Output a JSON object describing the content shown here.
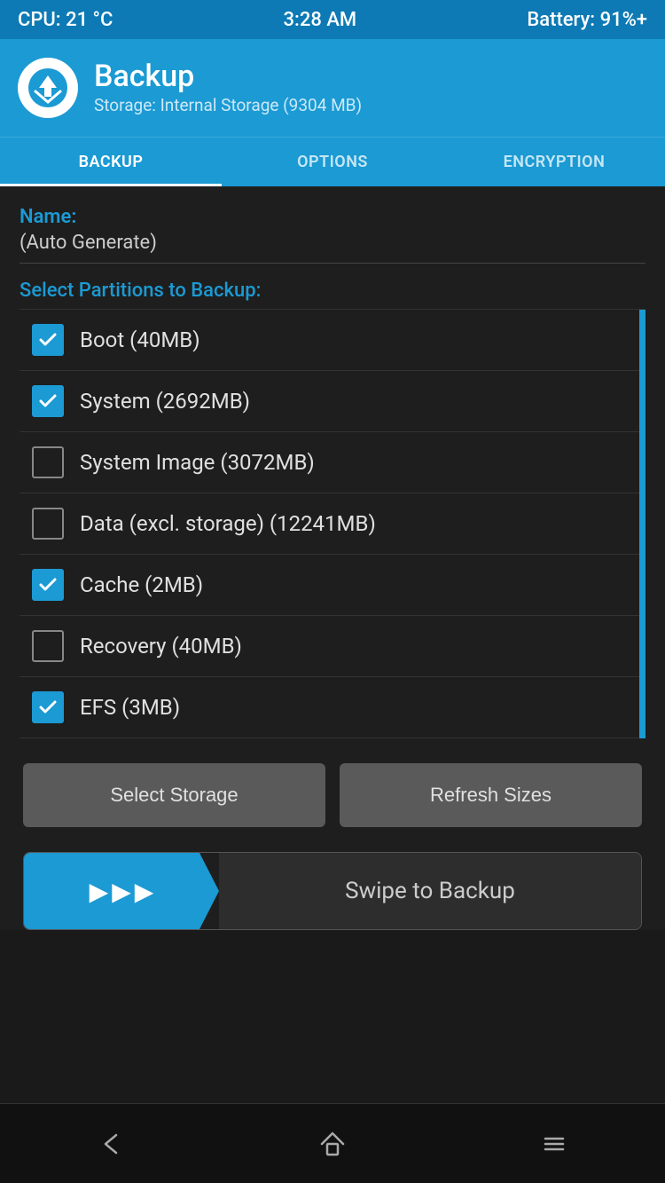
{
  "statusBar": {
    "cpu": "CPU: 21 °C",
    "time": "3:28 AM",
    "battery": "Battery: 91%+"
  },
  "header": {
    "title": "Backup",
    "subtitle": "Storage: Internal Storage (9304 MB)"
  },
  "tabs": [
    {
      "label": "BACKUP",
      "active": true
    },
    {
      "label": "OPTIONS",
      "active": false
    },
    {
      "label": "ENCRYPTION",
      "active": false
    }
  ],
  "nameLabel": "Name:",
  "nameValue": "(Auto Generate)",
  "sectionTitle": "Select Partitions to Backup:",
  "partitions": [
    {
      "label": "Boot (40MB)",
      "checked": true
    },
    {
      "label": "System (2692MB)",
      "checked": true
    },
    {
      "label": "System Image (3072MB)",
      "checked": false
    },
    {
      "label": "Data (excl. storage) (12241MB)",
      "checked": false
    },
    {
      "label": "Cache (2MB)",
      "checked": true
    },
    {
      "label": "Recovery (40MB)",
      "checked": false
    },
    {
      "label": "EFS (3MB)",
      "checked": true
    }
  ],
  "buttons": {
    "selectStorage": "Select Storage",
    "refreshSizes": "Refresh Sizes"
  },
  "swipe": {
    "label": "Swipe to Backup"
  },
  "bottomNav": {
    "back": "back-icon",
    "home": "home-icon",
    "menu": "menu-icon"
  }
}
